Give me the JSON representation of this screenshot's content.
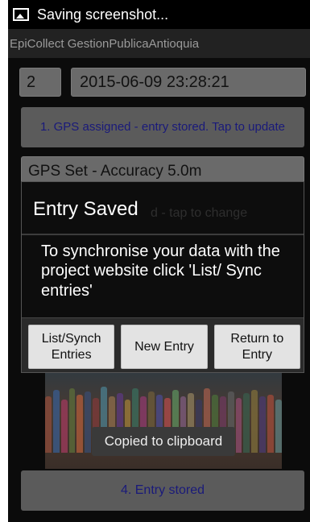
{
  "status_bar": {
    "icon": "image-icon",
    "text": "Saving screenshot..."
  },
  "app": {
    "title": "EpiCollect GestionPublicaAntioquia"
  },
  "form": {
    "entry_id": "2",
    "entry_datetime": "2015-06-09 23:28:21",
    "gps_button": "1. GPS assigned - entry stored. Tap to update",
    "gps_status": "GPS Set - Accuracy 5.0m",
    "entry_stored_button": "4. Entry stored"
  },
  "dialog": {
    "title": "Entry Saved",
    "background_text": "d - tap to change",
    "message": "To synchronise your data with the project website click 'List/ Sync entries'",
    "buttons": {
      "list_sync": "List/Synch Entries",
      "new_entry": "New Entry",
      "return": "Return to Entry"
    }
  },
  "toast": {
    "text": "Copied to clipboard"
  }
}
